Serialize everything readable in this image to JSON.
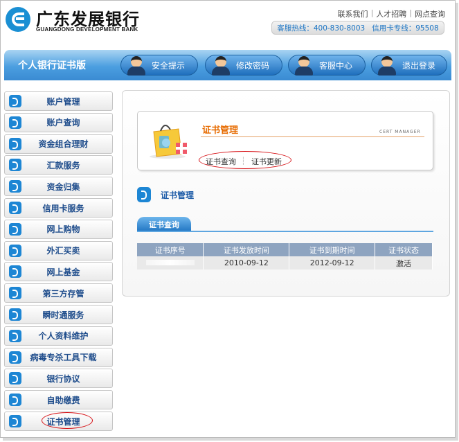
{
  "header": {
    "brand_cn": "广东发展银行",
    "brand_en": "GUANGDONG DEVELOPMENT BANK",
    "links": [
      "联系我们",
      "人才招聘",
      "网点查询"
    ],
    "hotline": "客服热线：400-830-8003",
    "card_hotline": "信用卡专线：95508"
  },
  "navbar": {
    "title": "个人银行证书版",
    "buttons": [
      "安全提示",
      "修改密码",
      "客服中心",
      "退出登录"
    ]
  },
  "sidebar": {
    "items": [
      "账户管理",
      "账户查询",
      "资金组合理财",
      "汇款服务",
      "资金归集",
      "信用卡服务",
      "网上购物",
      "外汇买卖",
      "网上基金",
      "第三方存管",
      "瞬时通服务",
      "个人资料维护",
      "病毒专杀工具下载",
      "银行协议",
      "自助缴费",
      "证书管理"
    ],
    "active_item": "证书管理"
  },
  "card": {
    "title": "证书管理",
    "subtitle_en": "CERT MANAGER",
    "links": [
      "证书查询",
      "证书更新"
    ]
  },
  "section": {
    "title": "证书管理",
    "tab": "证书查询"
  },
  "table": {
    "headers": [
      "证书序号",
      "证书发放时间",
      "证书到期时间",
      "证书状态"
    ],
    "rows": [
      {
        "serial": "",
        "issued": "2010-09-12",
        "expires": "2012-09-12",
        "status": "激活"
      }
    ]
  },
  "colors": {
    "brand_blue": "#1a8fd3",
    "nav_blue": "#3a8bd2",
    "title_orange": "#e76b00",
    "annotation_red": "#d60d12"
  }
}
